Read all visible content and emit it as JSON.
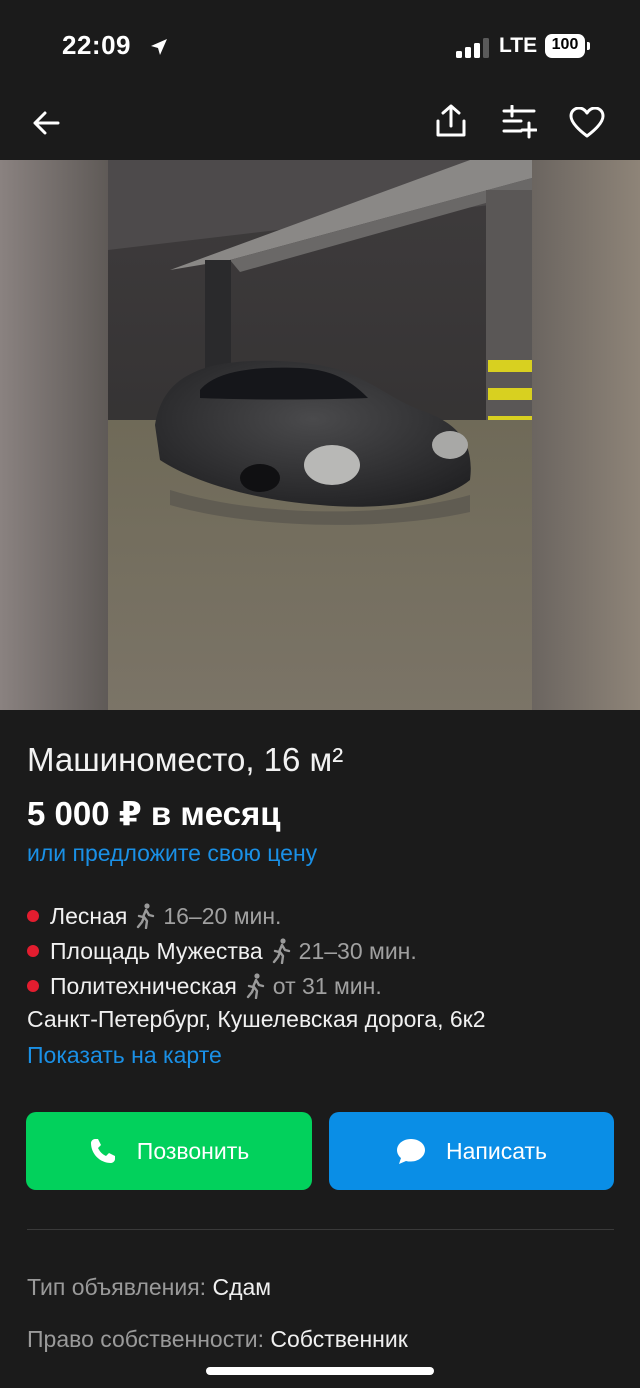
{
  "status_bar": {
    "time": "22:09",
    "network": "LTE",
    "battery": "100"
  },
  "nav": {
    "icons": [
      "back-arrow-icon",
      "share-icon",
      "compare-list-icon",
      "heart-icon"
    ]
  },
  "listing": {
    "title": "Машиноместо, 16 м²",
    "price": "5 000 ₽ в месяц",
    "offer_link": "или предложите свою цену",
    "metro": [
      {
        "name": "Лесная",
        "time": "16–20 мин."
      },
      {
        "name": "Площадь Мужества",
        "time": "21–30 мин."
      },
      {
        "name": "Политехническая",
        "time": "от 31 мин."
      }
    ],
    "address": "Санкт-Петербург, Кушелевская дорога, 6к2",
    "map_link": "Показать на карте"
  },
  "actions": {
    "call": "Позвонить",
    "message": "Написать"
  },
  "params": [
    {
      "key": "Тип объявления:",
      "value": "Сдам"
    },
    {
      "key": "Право собственности:",
      "value": "Собственник"
    }
  ],
  "colors": {
    "background": "#1b1b1b",
    "link": "#1a90e6",
    "call_button": "#02d15c",
    "message_button": "#0a8ee6",
    "metro_dot": "#e31d2f"
  }
}
